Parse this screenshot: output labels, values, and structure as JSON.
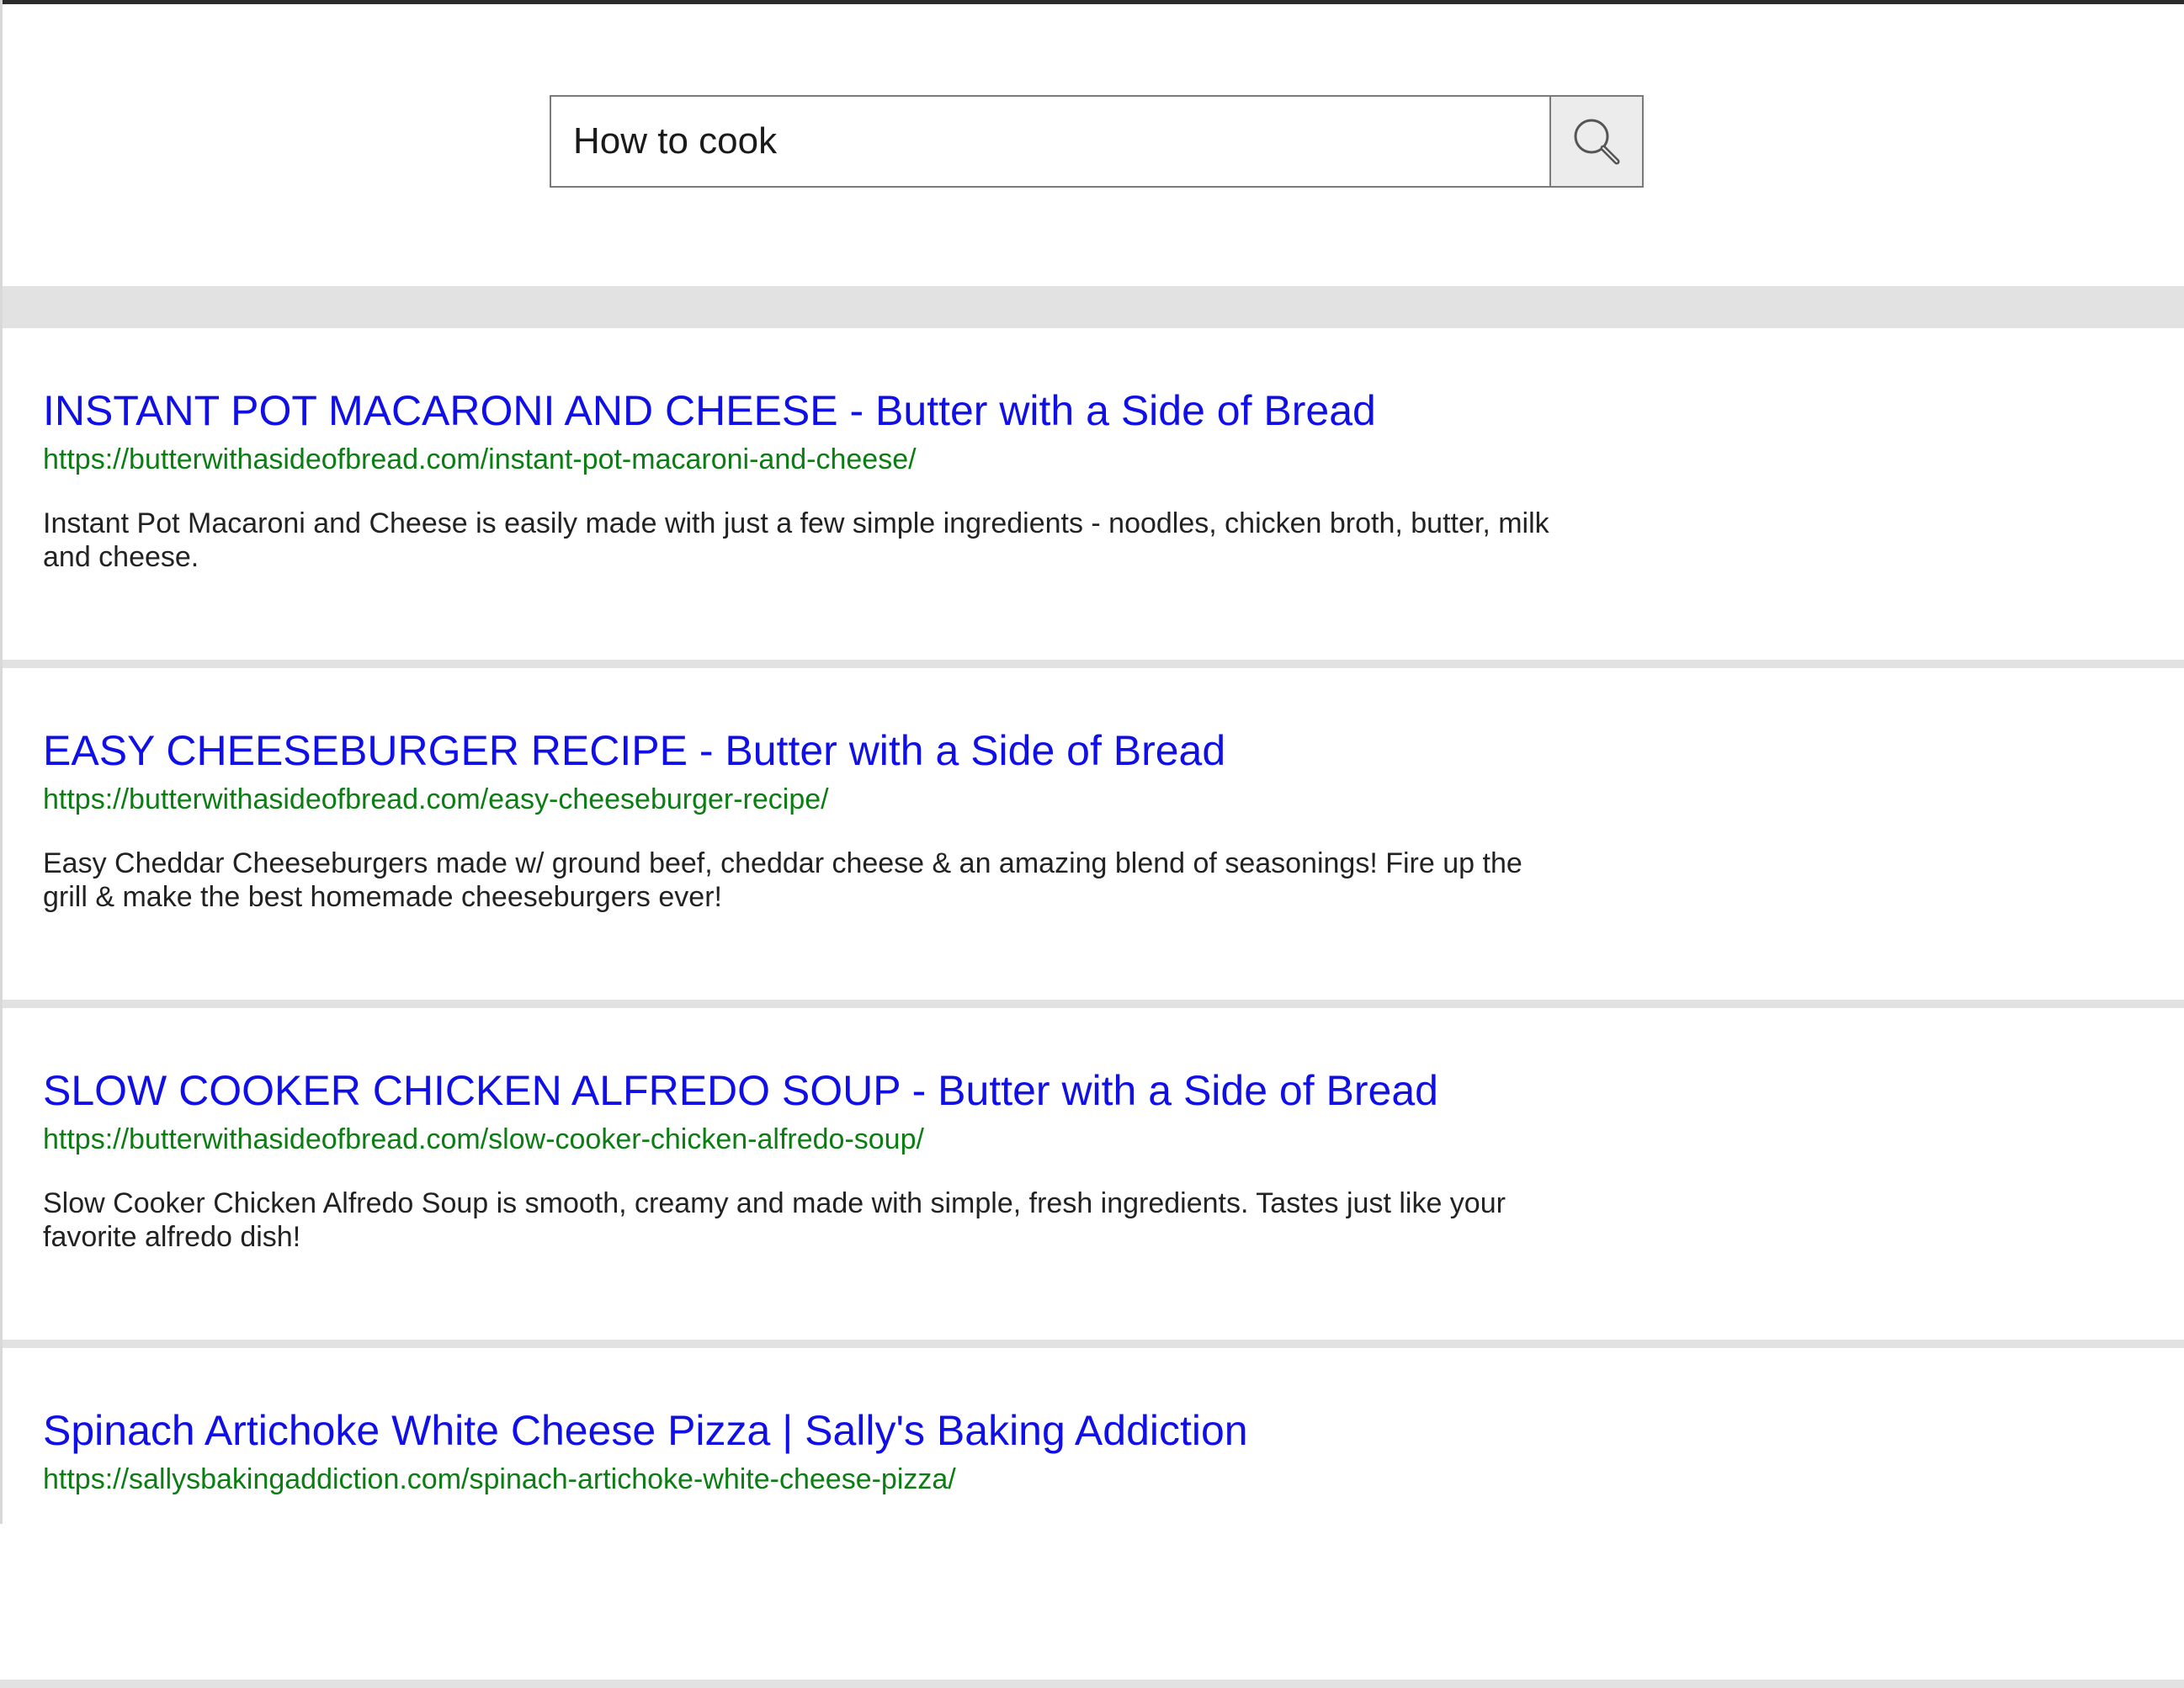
{
  "search": {
    "query": "How to cook",
    "button_icon": "search-icon"
  },
  "colors": {
    "title_link": "#1010e6",
    "url": "#0b7d12",
    "snippet": "#222222",
    "divider": "#e2e2e2"
  },
  "results": [
    {
      "title": "INSTANT POT MACARONI AND CHEESE - Butter with a Side of Bread",
      "url": "https://butterwithasideofbread.com/instant-pot-macaroni-and-cheese/",
      "snippet": "Instant Pot Macaroni and Cheese is easily made with just a few simple ingredients - noodles, chicken broth, butter, milk and cheese."
    },
    {
      "title": "EASY CHEESEBURGER RECIPE - Butter with a Side of Bread",
      "url": "https://butterwithasideofbread.com/easy-cheeseburger-recipe/",
      "snippet": "Easy Cheddar Cheeseburgers made w/ ground beef, cheddar cheese & an amazing blend of seasonings! Fire up the grill & make the best homemade cheeseburgers ever!"
    },
    {
      "title": "SLOW COOKER CHICKEN ALFREDO SOUP - Butter with a Side of Bread",
      "url": "https://butterwithasideofbread.com/slow-cooker-chicken-alfredo-soup/",
      "snippet": "Slow Cooker Chicken Alfredo Soup is smooth, creamy and made with simple, fresh ingredients. Tastes just like your favorite alfredo dish!"
    },
    {
      "title": "Spinach Artichoke White Cheese Pizza | Sally's Baking Addiction",
      "url": "https://sallysbakingaddiction.com/spinach-artichoke-white-cheese-pizza/",
      "snippet": ""
    }
  ]
}
